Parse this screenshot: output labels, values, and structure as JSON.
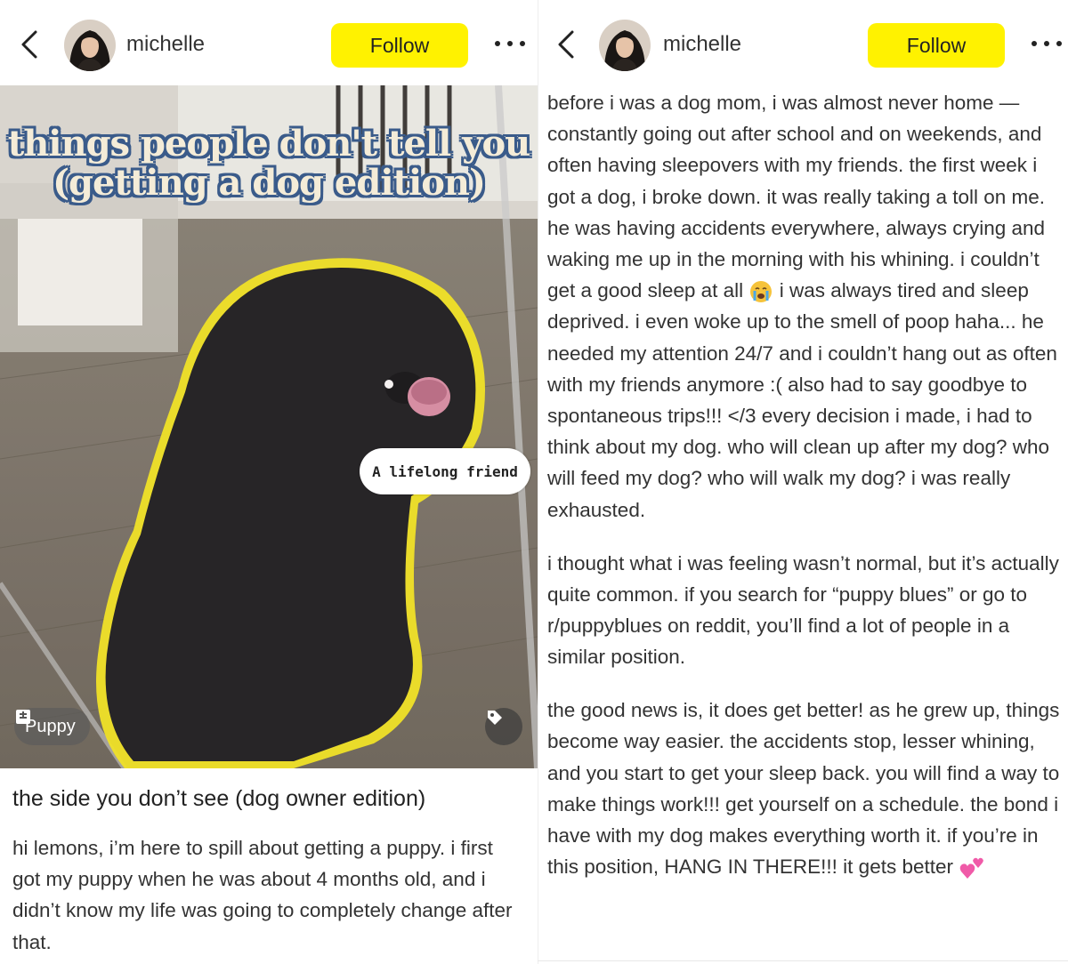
{
  "left": {
    "header": {
      "username": "michelle",
      "follow_label": "Follow"
    },
    "image": {
      "headline_line1": "things people don't tell you",
      "headline_line2": "(getting a dog edition)",
      "bubble_text": "A lifelong friend",
      "tag_label": "Puppy"
    },
    "post": {
      "title": "the side you don’t see (dog owner edition)",
      "body": "hi lemons, i’m here to spill about getting a puppy. i first got my puppy when he was about 4 months old, and i didn’t know my life was going to completely change after that."
    }
  },
  "right": {
    "header": {
      "username": "michelle",
      "follow_label": "Follow"
    },
    "paragraph1_a": "before i was a dog mom, i was almost never home — constantly going out after school and on weekends, and often having sleepovers with my friends. the first week i got a dog, i broke down. it was really taking a toll on me. he was having accidents everywhere, always crying and waking me up in the morning with his whining. i couldn’t get a good sleep at all",
    "paragraph1_b": " i was always tired and sleep deprived. i even woke up to the smell of poop haha... he needed my attention 24/7 and i couldn’t hang out as often with my friends anymore :( also had to say goodbye to spontaneous trips!!! </3 every decision i made, i had to think about my dog. who will clean up after my dog? who will feed my dog? who will walk my dog? i was really exhausted.",
    "paragraph2": "i thought what i was feeling wasn’t normal, but it’s actually quite common. if you search for “puppy blues” or go to r/puppyblues on reddit, you’ll find a lot of people in a similar position.",
    "paragraph3": "the good news is, it does get better! as he grew up, things become way easier. the accidents stop, lesser whining, and you start to get your sleep back. you will find a way to make things work!!! get yourself on a schedule. the bond i have with my dog makes everything worth it. if you’re in this position, HANG IN THERE!!! it gets better",
    "emojis": [
      "crying-face",
      "two-hearts"
    ]
  },
  "colors": {
    "follow_bg": "#fff200",
    "headline_outline": "#3a5b8a",
    "dog_outline": "#f0e020"
  }
}
